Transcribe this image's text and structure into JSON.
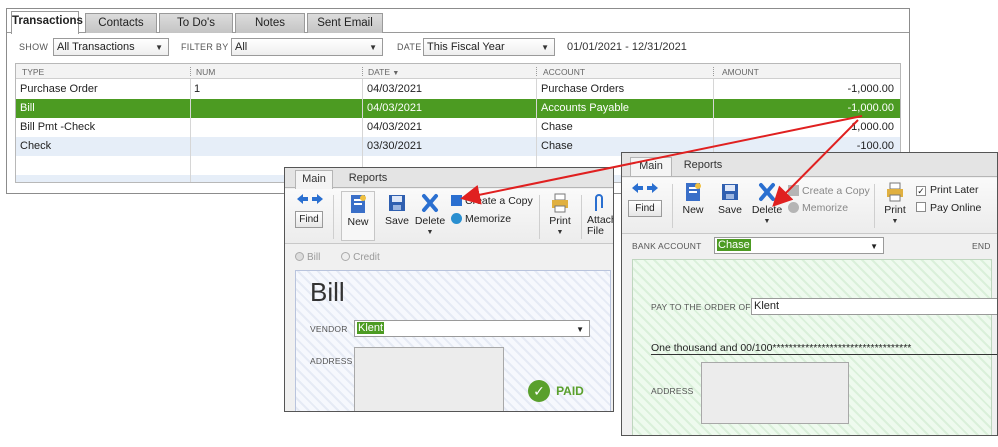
{
  "tabs": [
    "Transactions",
    "Contacts",
    "To Do's",
    "Notes",
    "Sent Email"
  ],
  "filters": {
    "show_label": "SHOW",
    "show_value": "All Transactions",
    "filter_label": "FILTER BY",
    "filter_value": "All",
    "date_label": "DATE",
    "date_value": "This Fiscal Year",
    "date_range": "01/01/2021 - 12/31/2021"
  },
  "table": {
    "headers": [
      "TYPE",
      "NUM",
      "DATE",
      "ACCOUNT",
      "AMOUNT"
    ],
    "rows": [
      {
        "type": "Purchase Order",
        "num": "1",
        "date": "04/03/2021",
        "account": "Purchase Orders",
        "amount": "-1,000.00"
      },
      {
        "type": "Bill",
        "num": "",
        "date": "04/03/2021",
        "account": "Accounts Payable",
        "amount": "-1,000.00",
        "selected": true
      },
      {
        "type": "Bill Pmt -Check",
        "num": "",
        "date": "04/03/2021",
        "account": "Chase",
        "amount": "1,000.00"
      },
      {
        "type": "Check",
        "num": "",
        "date": "03/30/2021",
        "account": "Chase",
        "amount": "-100.00"
      }
    ]
  },
  "bill_window": {
    "tabs": [
      "Main",
      "Reports"
    ],
    "find": "Find",
    "new": "New",
    "save": "Save",
    "delete": "Delete",
    "create_copy": "Create a Copy",
    "memorize": "Memorize",
    "print": "Print",
    "attach": "Attach File",
    "radio_bill": "Bill",
    "radio_credit": "Credit",
    "title": "Bill",
    "vendor_label": "VENDOR",
    "vendor_value": "Klent",
    "address_label": "ADDRESS",
    "paid_stamp": "PAID"
  },
  "check_window": {
    "tabs": [
      "Main",
      "Reports"
    ],
    "find": "Find",
    "new": "New",
    "save": "Save",
    "delete": "Delete",
    "create_copy": "Create a Copy",
    "memorize": "Memorize",
    "print": "Print",
    "print_later": "Print Later",
    "pay_online": "Pay Online",
    "bank_label": "BANK ACCOUNT",
    "bank_value": "Chase",
    "ending_label": "END",
    "pay_to_label": "PAY TO THE ORDER OF",
    "pay_to_value": "Klent",
    "amount_words": "One thousand  and 00/100**********************************",
    "address_label": "ADDRESS"
  },
  "colors": {
    "selected_row": "#4c9b22",
    "arrow": "#e02020",
    "paid_green": "#5aa02c"
  }
}
